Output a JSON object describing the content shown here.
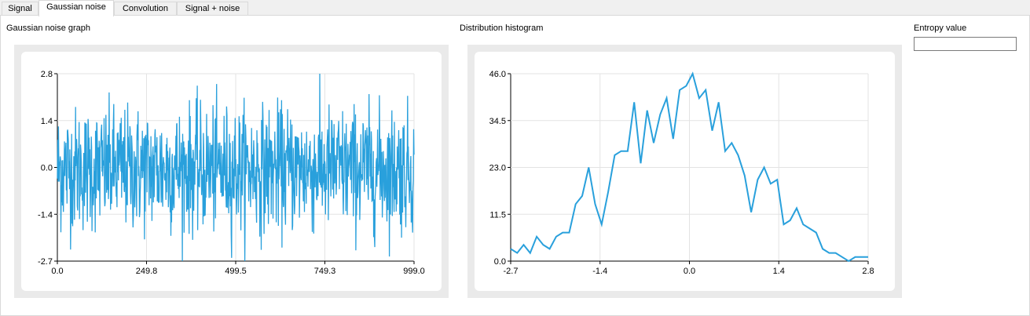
{
  "tabs": [
    {
      "label": "Signal"
    },
    {
      "label": "Gaussian noise",
      "active": true
    },
    {
      "label": "Convolution"
    },
    {
      "label": "Signal + noise"
    }
  ],
  "noise_graph": {
    "label": "Gaussian noise graph"
  },
  "histogram": {
    "label": "Distribution histogram"
  },
  "entropy": {
    "label": "Entropy value",
    "value": ""
  },
  "colors": {
    "series": "#29a0dc",
    "grid": "#e3e3e3",
    "frame": "#eaeaea"
  },
  "chart_data": [
    {
      "type": "line",
      "title": "",
      "series": [
        {
          "values_note": "1000 random gaussian samples (dense noise trace)"
        }
      ],
      "x_ticks": [
        "0.0",
        "249.8",
        "499.5",
        "749.3",
        "999.0"
      ],
      "y_ticks": [
        "2.8",
        "1.4",
        "0.0",
        "-1.4",
        "-2.7"
      ],
      "xlim": [
        0,
        999
      ],
      "ylim": [
        -2.7,
        2.8
      ],
      "grid": true
    },
    {
      "type": "line",
      "title": "",
      "x_ticks": [
        "-2.7",
        "-1.4",
        "0.0",
        "1.4",
        "2.8"
      ],
      "y_ticks": [
        "46.0",
        "34.5",
        "23.0",
        "11.5",
        "0.0"
      ],
      "xlim": [
        -2.7,
        2.8
      ],
      "ylim": [
        0,
        46
      ],
      "grid": true,
      "x": [
        -2.7,
        -2.6,
        -2.5,
        -2.4,
        -2.3,
        -2.2,
        -2.1,
        -2.0,
        -1.9,
        -1.8,
        -1.7,
        -1.6,
        -1.5,
        -1.4,
        -1.3,
        -1.2,
        -1.1,
        -1.0,
        -0.9,
        -0.8,
        -0.7,
        -0.6,
        -0.5,
        -0.4,
        -0.3,
        -0.2,
        -0.1,
        0.0,
        0.1,
        0.2,
        0.3,
        0.4,
        0.5,
        0.6,
        0.7,
        0.8,
        0.9,
        1.0,
        1.1,
        1.2,
        1.3,
        1.4,
        1.5,
        1.6,
        1.7,
        1.8,
        1.9,
        2.0,
        2.1,
        2.2,
        2.3,
        2.4,
        2.5,
        2.6,
        2.7,
        2.8
      ],
      "values": [
        3,
        2,
        4,
        2,
        6,
        4,
        3,
        6,
        7,
        7,
        14,
        16,
        23,
        14,
        9,
        17,
        26,
        27,
        27,
        39,
        24,
        37,
        29,
        36,
        40,
        30,
        42,
        43,
        46,
        40,
        42,
        32,
        39,
        27,
        29,
        26,
        21,
        12,
        20,
        23,
        19,
        20,
        9,
        10,
        13,
        9,
        8,
        7,
        3,
        2,
        2,
        1,
        0,
        1,
        1,
        1
      ]
    }
  ]
}
